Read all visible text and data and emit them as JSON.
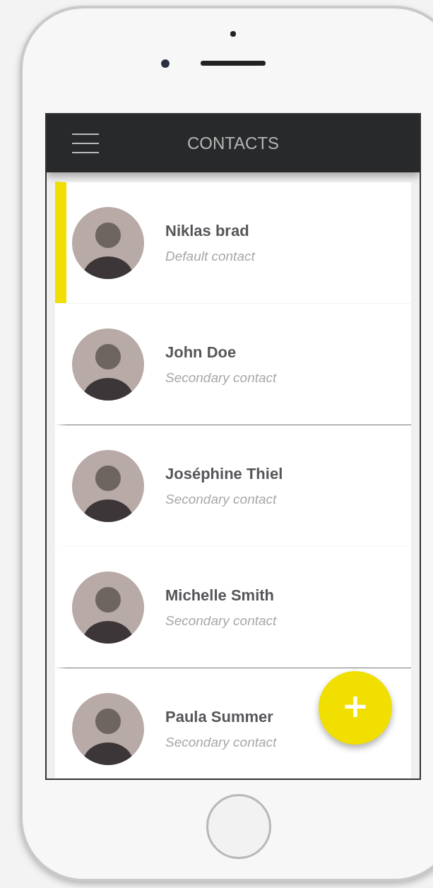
{
  "header": {
    "title": "CONTACTS"
  },
  "contacts": [
    {
      "name": "Niklas brad",
      "subtitle": "Default contact",
      "selected": true,
      "divider_above": false
    },
    {
      "name": "John Doe",
      "subtitle": "Secondary contact",
      "selected": false,
      "divider_above": false
    },
    {
      "name": "Joséphine Thiel",
      "subtitle": "Secondary contact",
      "selected": false,
      "divider_above": true
    },
    {
      "name": "Michelle Smith",
      "subtitle": "Secondary contact",
      "selected": false,
      "divider_above": false
    },
    {
      "name": "Paula Summer",
      "subtitle": "Secondary contact",
      "selected": false,
      "divider_above": true
    }
  ],
  "fab": {
    "label": "+"
  }
}
